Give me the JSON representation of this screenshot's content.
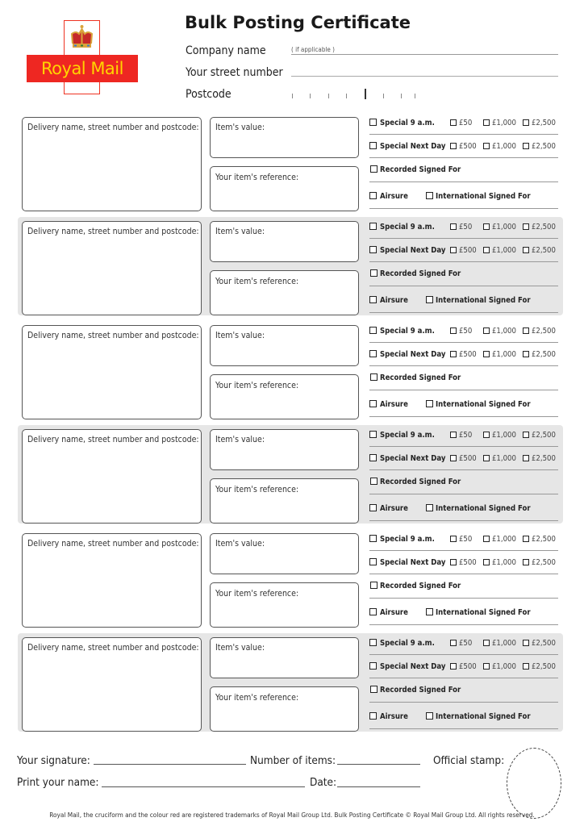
{
  "header": {
    "title": "Bulk Posting Certificate",
    "logo_text": "Royal Mail",
    "company_name_label": "Company name",
    "company_name_hint": "( if applicable )",
    "street_number_label": "Your street number",
    "postcode_label": "Postcode",
    "company_name_value": "",
    "street_number_value": "",
    "postcode_value": ""
  },
  "colors": {
    "brand_red": "#ee2722",
    "brand_yellow": "#ffd400",
    "shaded_bg": "#e6e6e6"
  },
  "item_labels": {
    "delivery": "Delivery name, street number and postcode:",
    "value": "Item's value:",
    "reference": "Your item's reference:"
  },
  "options": {
    "special_9am": "Special 9 a.m.",
    "special_9am_values": [
      "£50",
      "£1,000",
      "£2,500"
    ],
    "special_next_day": "Special Next Day",
    "special_next_day_values": [
      "£500",
      "£1,000",
      "£2,500"
    ],
    "recorded": "Recorded Signed For",
    "airsure": "Airsure",
    "international": "International Signed For"
  },
  "items": [
    {
      "shaded": false
    },
    {
      "shaded": true
    },
    {
      "shaded": false
    },
    {
      "shaded": true
    },
    {
      "shaded": false
    },
    {
      "shaded": true
    }
  ],
  "footer": {
    "signature_label": "Your signature:",
    "items_count_label": "Number of items:",
    "stamp_label": "Official stamp:",
    "print_name_label": "Print your name:",
    "date_label": "Date:",
    "legal": "Royal Mail, the cruciform and the colour red are registered trademarks of Royal Mail Group Ltd. Bulk Posting Certificate © Royal Mail Group Ltd. All rights reserved."
  }
}
